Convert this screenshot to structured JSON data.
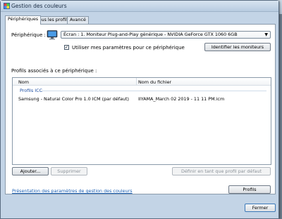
{
  "window": {
    "title": "Gestion des couleurs"
  },
  "tabs": [
    {
      "label": "Périphériques"
    },
    {
      "label": "Tous les profils"
    },
    {
      "label": "Avancé"
    }
  ],
  "device": {
    "label": "Périphérique :",
    "selected": "Écran : 1. Moniteur Plug-and-Play générique - NVIDIA GeForce GTX 1060 6GB",
    "use_settings_label": "Utiliser mes paramètres pour ce périphérique",
    "use_settings_checked": true,
    "identify_button": "Identifier les moniteurs"
  },
  "profiles": {
    "section_label": "Profils associés à ce périphérique :",
    "columns": [
      "Nom",
      "Nom du fichier"
    ],
    "group": "Profils ICC",
    "rows": [
      {
        "name": "Samsung - Natural Color Pro 1.0 ICM (par défaut)",
        "file": "IIYAMA_March 02 2019 - 11 11 PM.icm"
      }
    ]
  },
  "buttons": {
    "add": "Ajouter...",
    "remove": "Supprimer",
    "set_default": "Définir en tant que profil par défaut",
    "profiles": "Profils",
    "close": "Fermer"
  },
  "link": "Présentation des paramètres de gestion des couleurs"
}
